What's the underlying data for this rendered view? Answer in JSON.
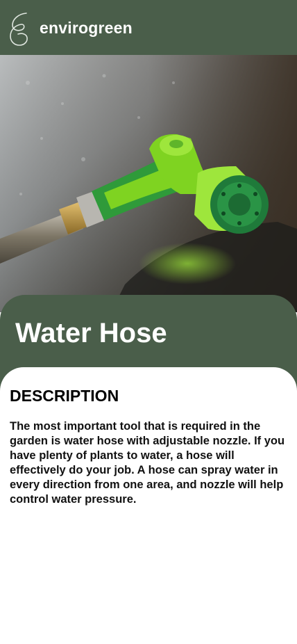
{
  "header": {
    "brand": "envirogreen",
    "logo_icon": "leaf-icon"
  },
  "hero": {
    "image": "water-hose-photo"
  },
  "product": {
    "title": "Water Hose"
  },
  "content": {
    "section_heading": "DESCRIPTION",
    "description": "The most important tool that is required in the garden is water hose with adjustable nozzle. If you have plenty of plants to water, a hose will effectively do your job. A hose can spray water in every direction from one area, and nozzle will help control water pressure."
  },
  "colors": {
    "primary": "#4a5e4a",
    "background": "#ffffff",
    "text": "#111111",
    "accent_green": "#7fd321"
  }
}
